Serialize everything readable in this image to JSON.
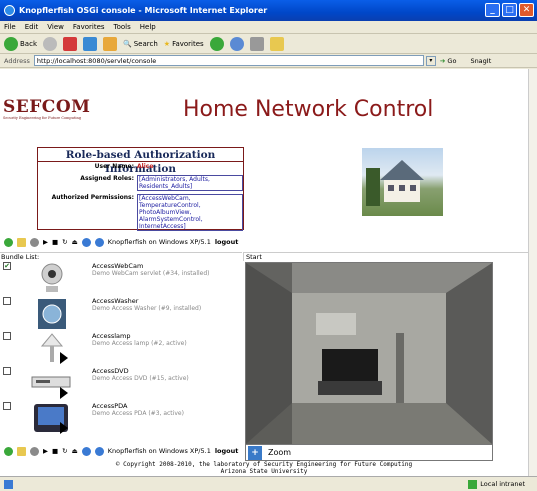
{
  "window": {
    "title": "Knopflerfish OSGi console - Microsoft Internet Explorer"
  },
  "menu": [
    "File",
    "Edit",
    "View",
    "Favorites",
    "Tools",
    "Help"
  ],
  "toolbar": {
    "back": "Back",
    "search": "Search",
    "favorites": "Favorites"
  },
  "address": {
    "label": "Address",
    "url": "http://localhost:8080/servlet/console",
    "go": "Go",
    "snagit": "SnagIt"
  },
  "header": {
    "logo": "SEFCOM",
    "logo_sub": "Security Engineering for Future Computing",
    "title": "Home Network Control"
  },
  "rbac": {
    "title": "Role-based Authorization Information",
    "user_label": "User Name:",
    "user_value": "Alice",
    "roles_label": "Assigned Roles:",
    "roles_value": "[Administrators, Adults, Residents_Adults]",
    "perms_label": "Authorized Permissions:",
    "perms_value": "[AccessWebCam, TemperatureControl, PhotoAlbumView, AlarmSystemControl, InternetAccess]"
  },
  "controls": {
    "platform": "Knopflerfish on Windows XP/5.1",
    "logout": "logout"
  },
  "bundle_list_label": "Bundle List:",
  "start_label": "Start",
  "bundles": [
    {
      "name": "AccessWebCam",
      "desc": "Demo WebCam servlet (#34, installed)",
      "checked": "✔"
    },
    {
      "name": "AccessWasher",
      "desc": "Demo Access Washer (#9, installed)",
      "checked": ""
    },
    {
      "name": "Accesslamp",
      "desc": "Demo Access lamp (#2, active)",
      "checked": ""
    },
    {
      "name": "AccessDVD",
      "desc": "Demo Access DVD (#15, active)",
      "checked": ""
    },
    {
      "name": "AccessPDA",
      "desc": "Demo Access PDA (#3, active)",
      "checked": ""
    }
  ],
  "zoom_label": "Zoom",
  "footer": {
    "line1": "© Copyright 2008-2010, the laboratory of Security Engineering for Future Computing",
    "line2": "Arizona State University"
  },
  "status": {
    "zone": "Local intranet"
  }
}
